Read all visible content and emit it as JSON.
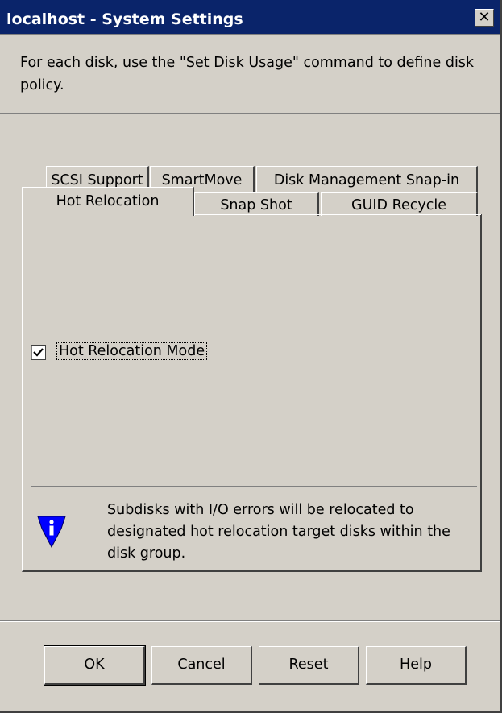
{
  "window": {
    "title": "localhost - System Settings",
    "close_glyph": "✕"
  },
  "instructions": "For each disk, use the \"Set Disk Usage\" command to define disk policy.",
  "tabs": {
    "back_row": [
      "SCSI Support",
      "SmartMove",
      "Disk Management Snap-in"
    ],
    "front_row": [
      "Hot Relocation",
      "Snap Shot",
      "GUID Recycle"
    ],
    "active": "Hot Relocation"
  },
  "hot_relocation": {
    "checkbox_label": "Hot Relocation Mode",
    "checked": true,
    "info_icon": "info-shield-icon",
    "info_text": "Subdisks with I/O errors will be relocated to designated hot relocation target disks within the disk group."
  },
  "buttons": {
    "ok": "OK",
    "cancel": "Cancel",
    "reset": "Reset",
    "help": "Help"
  },
  "colors": {
    "title_bar": "#0a246a",
    "face": "#d4d0c8",
    "info_icon": "#0000ff"
  }
}
